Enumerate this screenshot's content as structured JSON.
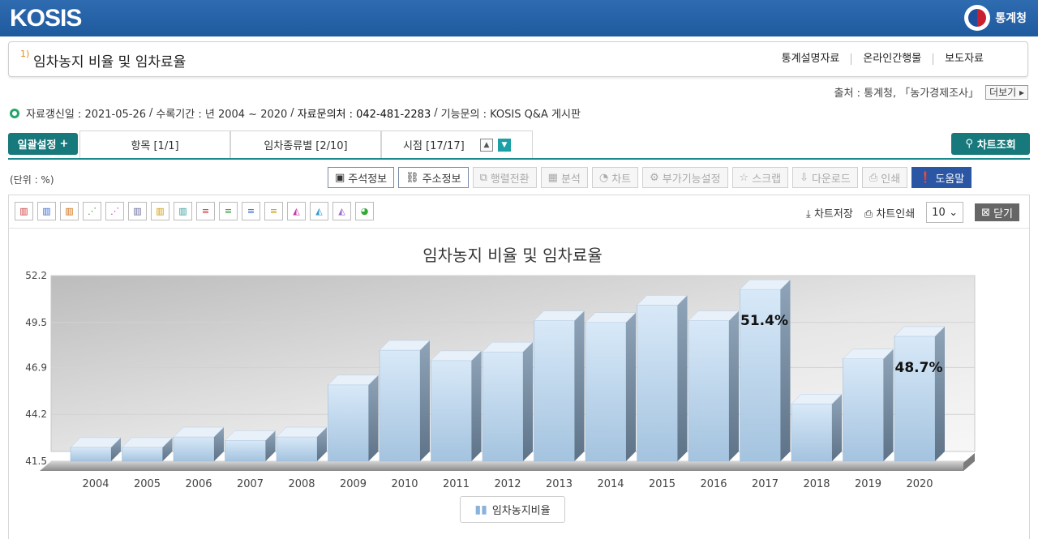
{
  "header": {
    "logo": "KOSIS",
    "agency": "통계청"
  },
  "title_bar": {
    "footnote": "1)",
    "title": "임차농지 비율 및 임차료율",
    "links": [
      "통계설명자료",
      "온라인간행물",
      "보도자료"
    ]
  },
  "source": {
    "text": "출처 : 통계청, 「농가경제조사」",
    "more_label": "더보기"
  },
  "meta": {
    "updated": "자료갱신일 : 2021-05-26",
    "period": "수록기간 : 년 2004 ~ 2020",
    "contact": "자료문의처 : 042-481-2283",
    "inquiry": "기능문의 : KOSIS Q&A 게시판"
  },
  "tabs": {
    "bulk_label": "일괄설정",
    "items": [
      "항목 [1/1]",
      "임차종류별 [2/10]",
      "시점 [17/17]"
    ],
    "chart_search": "차트조회"
  },
  "unit": "(단위 : %)",
  "toolbar": [
    "주석정보",
    "주소정보",
    "행렬전환",
    "분석",
    "차트",
    "부가기능설정",
    "스크랩",
    "다운로드",
    "인쇄",
    "도움말"
  ],
  "chart_panel": {
    "save": "차트저장",
    "print": "차트인쇄",
    "rows": "10",
    "close": "닫기"
  },
  "colors": {
    "bar": "#aecde6",
    "accent": "#17797b",
    "header": "#2566ac"
  },
  "chart_data": {
    "type": "bar",
    "title": "임차농지 비율 및 임차료율",
    "categories": [
      "2004",
      "2005",
      "2006",
      "2007",
      "2008",
      "2009",
      "2010",
      "2011",
      "2012",
      "2013",
      "2014",
      "2015",
      "2016",
      "2017",
      "2018",
      "2019",
      "2020"
    ],
    "series": [
      {
        "name": "임차농지비율",
        "values": [
          42.3,
          42.3,
          42.9,
          42.7,
          42.9,
          45.9,
          47.9,
          47.3,
          47.8,
          49.6,
          49.5,
          50.5,
          49.6,
          51.4,
          44.8,
          47.4,
          48.7
        ]
      }
    ],
    "yticks": [
      "52.2",
      "49.5",
      "46.9",
      "44.2",
      "41.5"
    ],
    "ylim": [
      41.5,
      52.2
    ],
    "data_labels": [
      {
        "category": "2017",
        "text": "51.4%"
      },
      {
        "category": "2020",
        "text": "48.7%"
      }
    ],
    "legend": "bottom"
  }
}
